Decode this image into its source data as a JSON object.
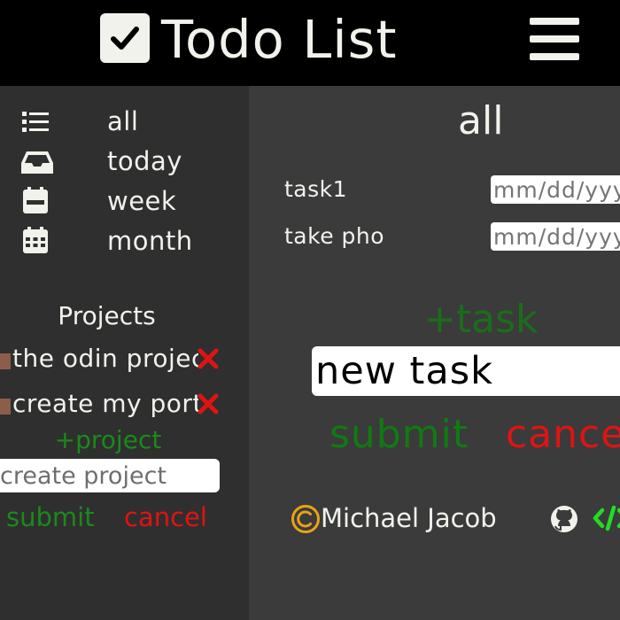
{
  "app": {
    "title": "Todo List",
    "logo_icon": "checkbox-icon",
    "menu_icon": "hamburger-menu-icon"
  },
  "sidebar": {
    "nav_items": [
      {
        "label": "all",
        "icon": "list-icon"
      },
      {
        "label": "today",
        "icon": "inbox-tray-icon"
      },
      {
        "label": "week",
        "icon": "calendar-week-icon"
      },
      {
        "label": "month",
        "icon": "calendar-month-icon"
      }
    ],
    "projects_heading": "Projects",
    "projects": [
      {
        "name": "the odin project",
        "delete_icon": "close-x-icon",
        "color": "#8b5e4a"
      },
      {
        "name": "create my portfolio",
        "delete_icon": "close-x-icon",
        "color": "#8b5e4a"
      }
    ],
    "add_project_label": "+project",
    "new_project_placeholder": "create project",
    "submit_label": "submit",
    "cancel_label": "cancel"
  },
  "main": {
    "title": "all",
    "tasks": [
      {
        "name": "task1",
        "date_placeholder": "mm/dd/yyyy"
      },
      {
        "name": "take photos",
        "date_placeholder": "mm/dd/yyyy"
      }
    ],
    "add_task_label": "+task",
    "new_task_value": "new task",
    "submit_label": "submit",
    "cancel_label": "cancel"
  },
  "footer": {
    "copyright_icon": "copyright-icon",
    "author": "Michael Jacob",
    "github_icon": "github-icon",
    "code_icon": "code-icon"
  },
  "colors": {
    "header_bg": "#000000",
    "sidebar_bg": "#2f2f2f",
    "main_bg": "#3b3b3b",
    "text": "#f2f2ec",
    "green": "#1a8a1a",
    "red": "#e01313",
    "copyright_orange": "#e8a317",
    "code_green": "#22dd22"
  }
}
